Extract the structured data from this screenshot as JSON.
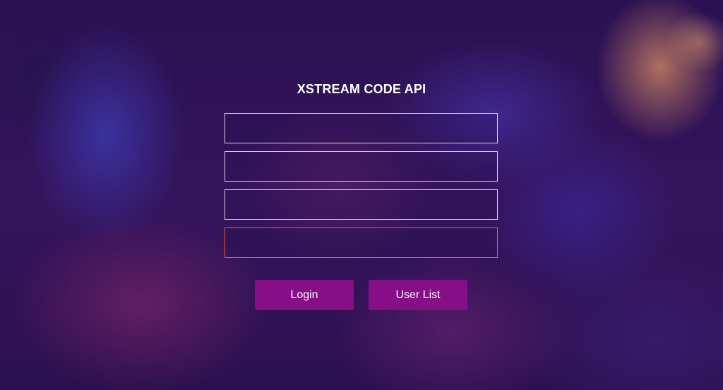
{
  "header": {
    "title": "XSTREAM CODE API"
  },
  "form": {
    "fields": [
      {
        "value": "",
        "placeholder": ""
      },
      {
        "value": "",
        "placeholder": ""
      },
      {
        "value": "",
        "placeholder": ""
      },
      {
        "value": "",
        "placeholder": ""
      }
    ],
    "focused_field_index": 3
  },
  "actions": {
    "login_label": "Login",
    "user_list_label": "User List"
  },
  "colors": {
    "button_bg": "#860e86",
    "field_border": "#d9d2e6",
    "focus_border": "#e8622a",
    "title_text": "#ffffff"
  }
}
